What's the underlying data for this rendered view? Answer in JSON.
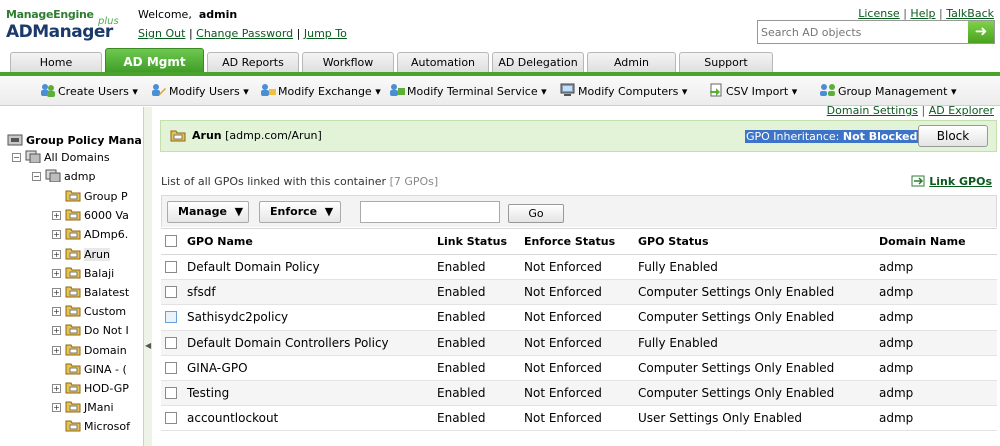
{
  "logo": {
    "line1": "ManageEngine",
    "line2": "ADManager",
    "plus": "plus"
  },
  "header": {
    "welcome_label": "Welcome,",
    "username": "admin",
    "sign_out": "Sign Out",
    "change_password": "Change Password",
    "jump_to": "Jump To",
    "license": "License",
    "help": "Help",
    "talkback": "TalkBack",
    "separator": "|",
    "search_placeholder": "Search AD objects",
    "search_go_icon": "arrow-right-icon"
  },
  "tabs": [
    {
      "label": "Home"
    },
    {
      "label": "AD Mgmt",
      "active": true
    },
    {
      "label": "AD Reports"
    },
    {
      "label": "Workflow"
    },
    {
      "label": "Automation"
    },
    {
      "label": "AD Delegation"
    },
    {
      "label": "Admin"
    },
    {
      "label": "Support"
    }
  ],
  "domain_links": {
    "settings": "Domain Settings",
    "explorer": "AD Explorer"
  },
  "submenu": [
    {
      "label": "Create Users"
    },
    {
      "label": "Modify Users"
    },
    {
      "label": "Modify Exchange"
    },
    {
      "label": "Modify Terminal Service"
    },
    {
      "label": "Modify Computers"
    },
    {
      "label": "CSV Import"
    },
    {
      "label": "Group Management"
    }
  ],
  "tree": {
    "root": "Group Policy Mana",
    "all_domains": "All Domains",
    "domain": "admp",
    "items": [
      {
        "label": "Group P",
        "expander": ""
      },
      {
        "label": "6000 Va",
        "expander": "+"
      },
      {
        "label": "ADmp6.",
        "expander": "+"
      },
      {
        "label": "Arun",
        "expander": "+",
        "selected": true
      },
      {
        "label": "Balaji",
        "expander": "+"
      },
      {
        "label": "Balatest",
        "expander": "+"
      },
      {
        "label": "Custom",
        "expander": "+"
      },
      {
        "label": "Do Not I",
        "expander": "+"
      },
      {
        "label": "Domain",
        "expander": "+"
      },
      {
        "label": "GINA - (",
        "expander": ""
      },
      {
        "label": "HOD-GP",
        "expander": "+"
      },
      {
        "label": "JMani",
        "expander": "+"
      },
      {
        "label": "Microsof",
        "expander": ""
      }
    ]
  },
  "container": {
    "name": "Arun",
    "path": "[admp.com/Arun]",
    "inheritance_label": "GPO Inheritance:",
    "inheritance_value": "Not Blocked",
    "block_button": "Block"
  },
  "list": {
    "info": "List of all GPOs linked with this container",
    "count": "[7 GPOs]",
    "link_gpos": "Link GPOs",
    "manage_button": "Manage",
    "enforce_button": "Enforce",
    "go_button": "Go",
    "columns": [
      "GPO Name",
      "Link Status",
      "Enforce Status",
      "GPO Status",
      "Domain Name"
    ],
    "rows": [
      {
        "name": "Default Domain Policy",
        "link": "Enabled",
        "enforce": "Not Enforced",
        "status": "Fully Enabled",
        "domain": "admp"
      },
      {
        "name": "sfsdf",
        "link": "Enabled",
        "enforce": "Not Enforced",
        "status": "Computer Settings Only Enabled",
        "domain": "admp"
      },
      {
        "name": "Sathisydc2policy",
        "link": "Enabled",
        "enforce": "Not Enforced",
        "status": "Computer Settings Only Enabled",
        "domain": "admp"
      },
      {
        "name": "Default Domain Controllers Policy",
        "link": "Enabled",
        "enforce": "Not Enforced",
        "status": "Fully Enabled",
        "domain": "admp"
      },
      {
        "name": "GINA-GPO",
        "link": "Enabled",
        "enforce": "Not Enforced",
        "status": "Computer Settings Only Enabled",
        "domain": "admp"
      },
      {
        "name": "Testing",
        "link": "Enabled",
        "enforce": "Not Enforced",
        "status": "Computer Settings Only Enabled",
        "domain": "admp"
      },
      {
        "name": "accountlockout",
        "link": "Enabled",
        "enforce": "Not Enforced",
        "status": "User Settings Only Enabled",
        "domain": "admp"
      }
    ]
  },
  "colors": {
    "accent": "#4aa32c",
    "active_tab": "#3d9a24",
    "link": "#0a5a1e",
    "highlight": "#3d74c8",
    "crumb_bg": "#e3f3d8"
  }
}
